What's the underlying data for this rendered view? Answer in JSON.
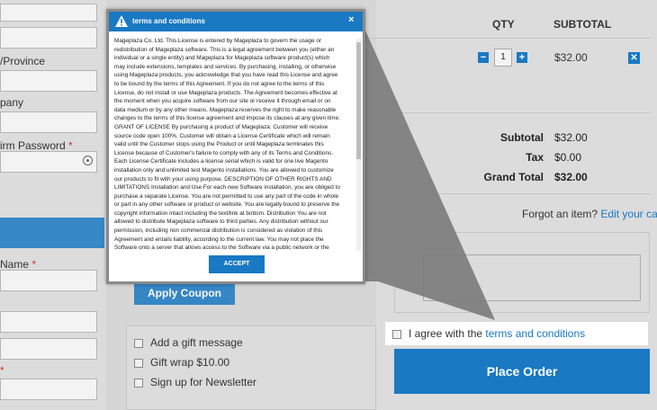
{
  "form": {
    "state_label": "/Province",
    "company_label": "pany",
    "confirm_password_label": "irm Password",
    "name_label": "Name",
    "required_mark": "*"
  },
  "cart": {
    "qty_header": "QTY",
    "subtotal_header": "SUBTOTAL",
    "qty_value": "1",
    "minus_icon": "−",
    "plus_icon": "+",
    "remove_icon": "✕",
    "line_subtotal": "$32.00",
    "totals": [
      {
        "label": "Subtotal",
        "value": "$32.00"
      },
      {
        "label": "Tax",
        "value": "$0.00"
      },
      {
        "label": "Grand Total",
        "value": "$32.00"
      }
    ],
    "forgot_text": "Forgot an item?",
    "edit_cart_link": "Edit your cart"
  },
  "coupon": {
    "button_label": "Apply Coupon"
  },
  "options": {
    "gift_message": "Add a gift message",
    "gift_wrap": "Gift wrap $10.00",
    "newsletter": "Sign up for Newsletter"
  },
  "agreement": {
    "prefix": "I agree with the",
    "link": "terms and conditions"
  },
  "place_order_label": "Place Order",
  "modal": {
    "title": "terms and conditions",
    "close": "×",
    "body": "Mageplaza Co. Ltd. This License is entered by Mageplaza to govern the usage or redistribution of Mageplaza software. This is a legal agreement between you (either an individual or a single entity) and Mageplaza for Mageplaza software product(s) which may include extensions, templates and services. By purchasing, installing, or otherwise using Mageplaza products, you acknowledge that you have read this License and agree to be bound by the terms of this Agreement. If you do not agree to the terms of this License, do not install or use Mageplaza products. The Agreement becomes effective at the moment when you acquire software from our site or receive it through email or on data medium or by any other means. Mageplaza reserves the right to make reasonable changes to the terms of this license agreement and impose its clauses at any given time. GRANT OF LICENSE By purchasing a product of Mageplaza: Customer will receive source code open 100%. Customer will obtain a License Certificate which will remain valid until the Customer stops using the Product or until Mageplaza terminates this License because of Customer's failure to comply with any of its Terms and Conditions. Each License Certificate includes a license serial which is valid for one live Magento installation only and unlimited test Magento installations. You are allowed to customize our products to fit with your using purpose. DESCRIPTION OF OTHER RIGHTS AND LIMITATIONS Installation and Use For each new Software installation, you are obliged to purchase a separate License. You are not permitted to use any part of the code in whole or part in any other software or product or website. You are legally bound to preserve the copyright information intact including the text/link at bottom. Distribution You are not allowed to distribute Mageplaza software to third parties. Any distribution without our permission, including non commercial distribution is considered as violation of this Agreement and entails liability, according to the current law. You may not place the Software onto a server that allows access to the Software via a public network or the Internet for",
    "accept_label": "ACCEPT"
  },
  "colors": {
    "accent": "#1979c3",
    "overlay": "#dcdcdc",
    "required": "#c0392b"
  }
}
